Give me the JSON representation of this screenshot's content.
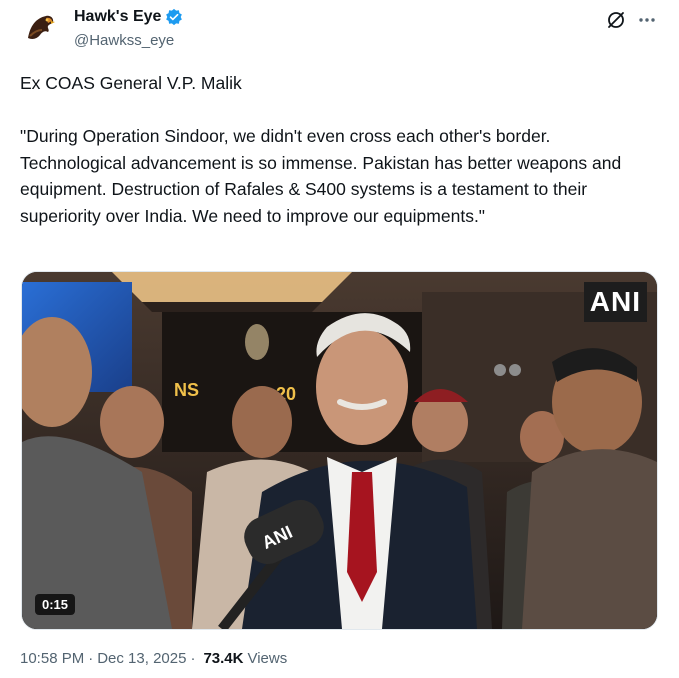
{
  "author": {
    "display_name": "Hawk's Eye",
    "handle": "@Hawkss_eye",
    "avatar_icon": "eagle-icon",
    "verified_icon": "verified-badge-icon",
    "verified_color": "#1d9bf0"
  },
  "tweet": {
    "text": "Ex COAS General V.P. Malik\n\n\"During Operation Sindoor, we didn't even cross each other's border. Technological advancement is so immense. Pakistan has better weapons and equipment. Destruction of Rafales & S400 systems is a testament to their superiority over India. We need to improve our equipments.\""
  },
  "media": {
    "watermark": "ANI",
    "mic_label": "ANI",
    "backdrop_text_left": "NS",
    "backdrop_text_right": "20",
    "duration": "0:15"
  },
  "meta": {
    "time": "10:58 PM",
    "separator": "·",
    "date": "Dec 13, 2025",
    "views_count": "73.4K",
    "views_label": "Views"
  }
}
